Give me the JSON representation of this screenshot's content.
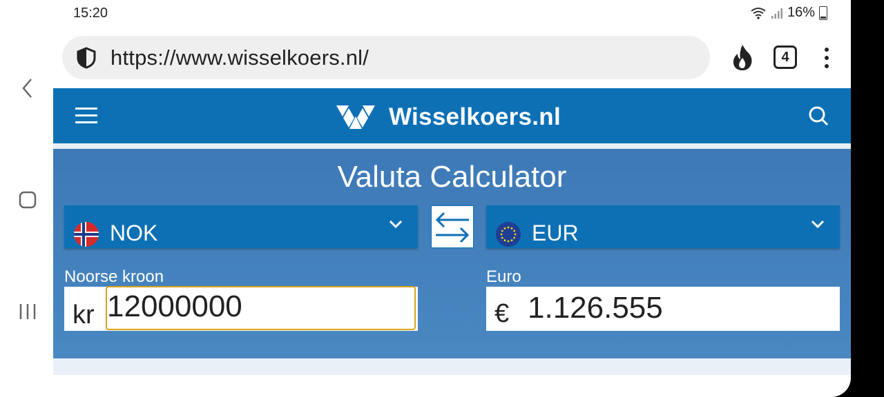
{
  "status_bar": {
    "time": "15:20",
    "battery": "16%"
  },
  "browser": {
    "url": "https://www.wisselkoers.nl/",
    "tab_count": "4"
  },
  "site": {
    "logo_text": "Wisselkoers.nl",
    "calculator_title": "Valuta Calculator",
    "from": {
      "code": "NOK",
      "label": "Noorse kroon",
      "prefix": "kr",
      "value": "12000000"
    },
    "to": {
      "code": "EUR",
      "label": "Euro",
      "prefix": "€",
      "value": "1.126.555"
    }
  },
  "colors": {
    "brand_blue": "#0d70b5",
    "calc_bg": "#4a88c2",
    "focus_border": "#d8a116"
  },
  "icons": [
    "shield-icon",
    "fire-icon",
    "tabs-icon",
    "more-vert-icon",
    "menu-icon",
    "search-icon",
    "chevron-down-icon",
    "swap-icon",
    "back-icon",
    "home-icon",
    "recents-icon"
  ]
}
